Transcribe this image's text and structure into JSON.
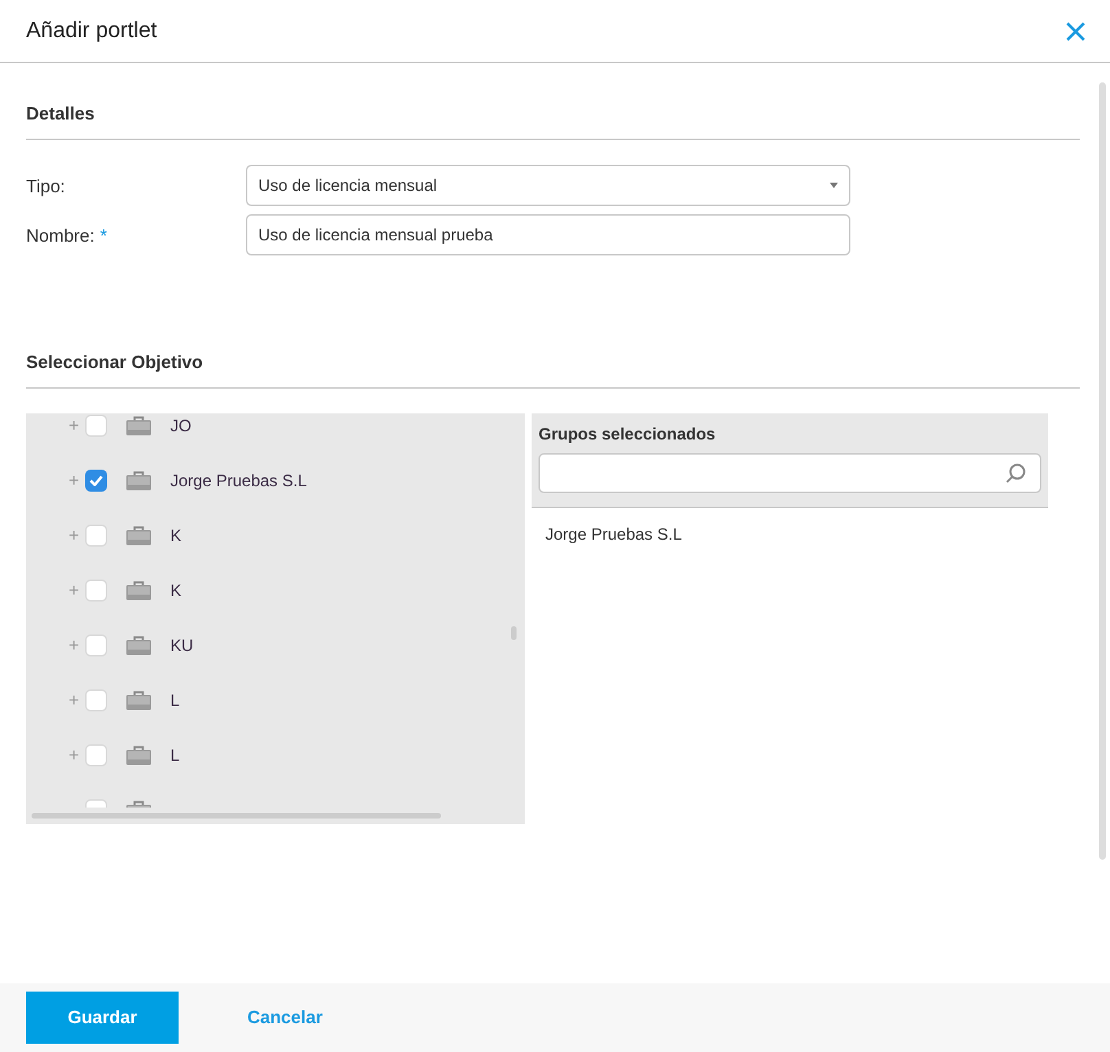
{
  "dialog": {
    "title": "Añadir portlet"
  },
  "details": {
    "heading": "Detalles",
    "fields": [
      {
        "kind": "select",
        "label": "Tipo:",
        "required": false,
        "value": "Uso de licencia mensual"
      },
      {
        "kind": "text",
        "label": "Nombre:",
        "required": true,
        "required_mark": "*",
        "value": "Uso de licencia mensual prueba"
      }
    ]
  },
  "target": {
    "heading": "Seleccionar Objetivo",
    "tree": [
      {
        "expander": "+",
        "label": "JO",
        "checked": false
      },
      {
        "expander": "+",
        "label": "Jorge Pruebas S.L",
        "checked": true
      },
      {
        "expander": "+",
        "label": "K",
        "checked": false
      },
      {
        "expander": "+",
        "label": "K",
        "checked": false
      },
      {
        "expander": "+",
        "label": "KU",
        "checked": false
      },
      {
        "expander": "+",
        "label": "L",
        "checked": false
      },
      {
        "expander": "+",
        "label": "L",
        "checked": false
      },
      {
        "checked": false
      }
    ],
    "selected_groups": {
      "heading": "Grupos seleccionados",
      "items": [
        "Jorge Pruebas S.L"
      ]
    }
  },
  "buttons": [
    {
      "kind": "primary",
      "label": "Guardar"
    },
    {
      "kind": "link",
      "label": "Cancelar"
    }
  ]
}
